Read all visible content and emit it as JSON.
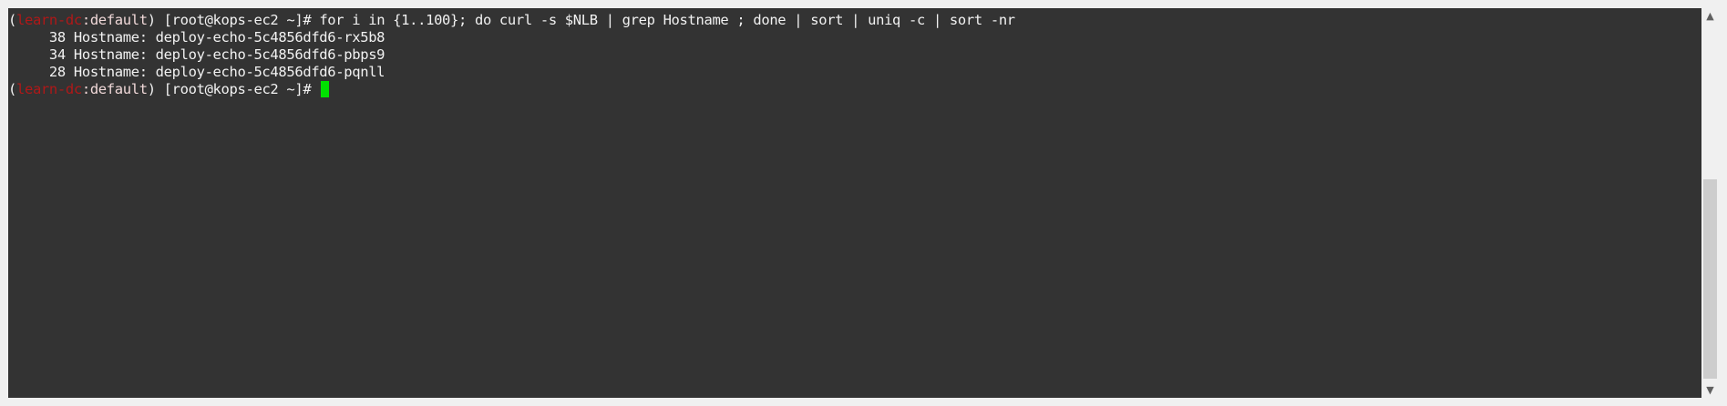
{
  "terminal": {
    "line1": {
      "paren_open": "(",
      "context": "learn-dc",
      "sep": ":",
      "namespace": "default",
      "paren_close": ")",
      "prompt": " [root@kops-ec2 ~]# ",
      "command": "for i in {1..100}; do curl -s $NLB | grep Hostname ; done | sort | uniq -c | sort -nr"
    },
    "output": [
      "     38 Hostname: deploy-echo-5c4856dfd6-rx5b8",
      "     34 Hostname: deploy-echo-5c4856dfd6-pbps9",
      "     28 Hostname: deploy-echo-5c4856dfd6-pqnll"
    ],
    "line5": {
      "paren_open": "(",
      "context": "learn-dc",
      "sep": ":",
      "namespace": "default",
      "paren_close": ")",
      "prompt": " [root@kops-ec2 ~]# "
    }
  },
  "scrollbar": {
    "up_glyph": "▲",
    "down_glyph": "▼"
  },
  "colors": {
    "background": "#333333",
    "foreground": "#f2f2f2",
    "context": "#b01818",
    "cursor": "#00e000"
  }
}
